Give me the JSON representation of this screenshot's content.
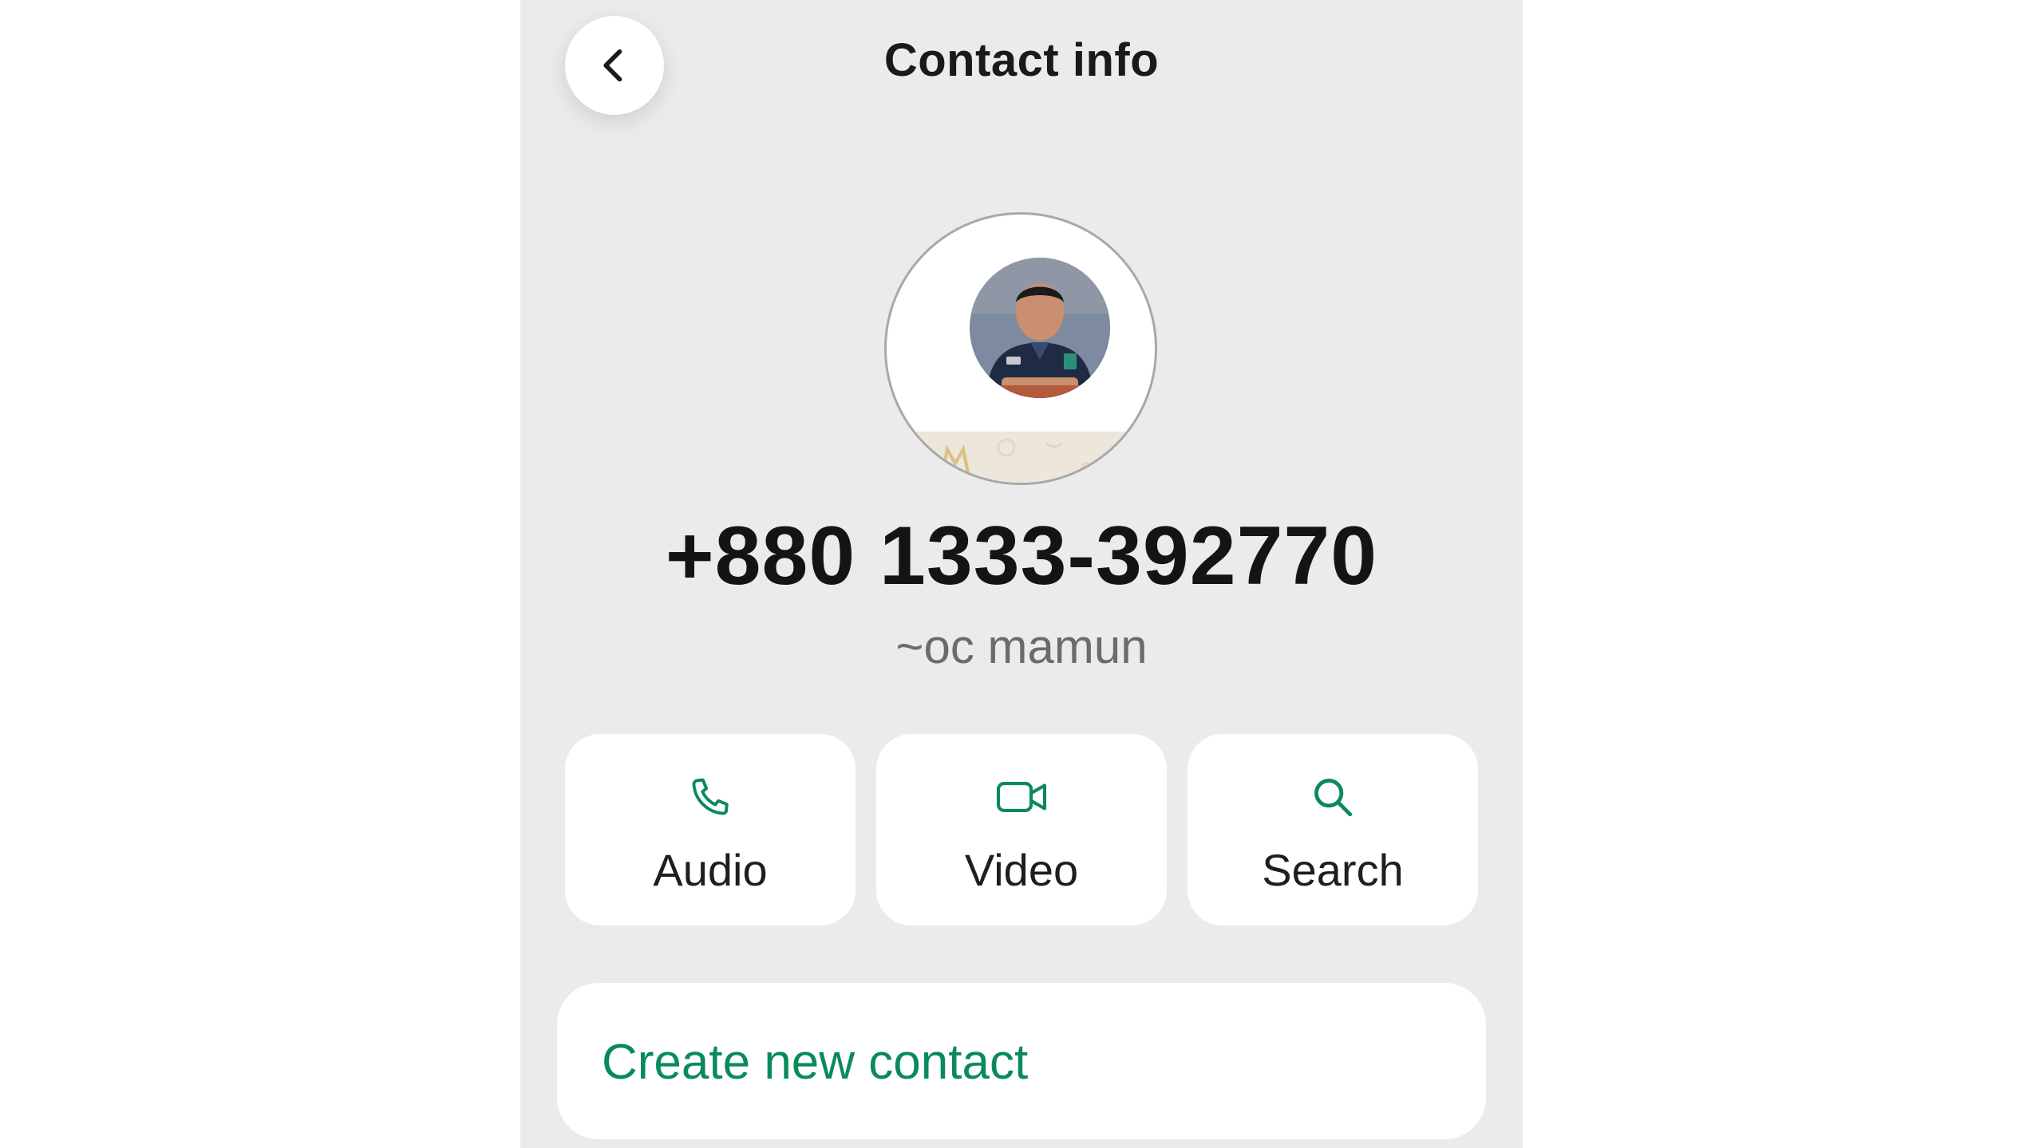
{
  "header": {
    "title": "Contact info",
    "back_icon": "chevron-left-icon"
  },
  "profile": {
    "phone_number": "+880 1333-392770",
    "push_name": "~oc mamun"
  },
  "actions": [
    {
      "label": "Audio",
      "icon": "phone-icon"
    },
    {
      "label": "Video",
      "icon": "video-camera-icon"
    },
    {
      "label": "Search",
      "icon": "search-icon"
    }
  ],
  "create_contact": {
    "label": "Create new contact"
  },
  "colors": {
    "accent": "#0a8a5a",
    "background": "#ebebeb",
    "card": "#ffffff",
    "text_primary": "#141414",
    "text_secondary": "#6b6b6b"
  }
}
